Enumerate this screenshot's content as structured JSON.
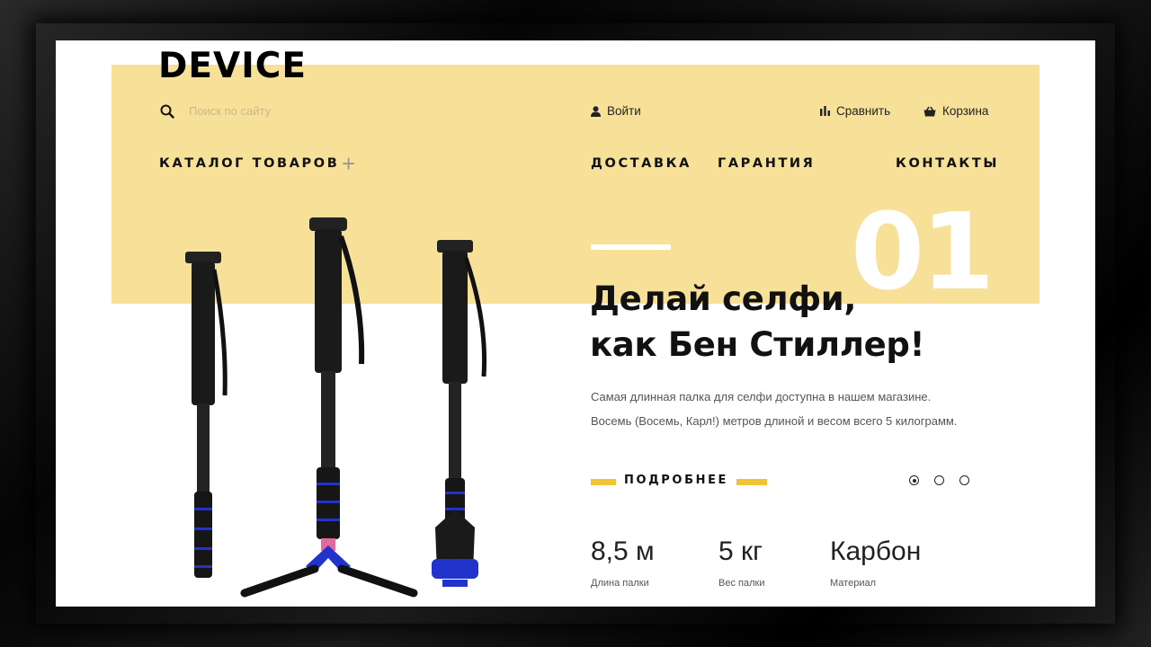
{
  "header": {
    "logo": "DEVICE",
    "search_placeholder": "Поиск по сайту",
    "login": "Войти",
    "compare": "Сравнить",
    "cart": "Корзина"
  },
  "nav": {
    "catalog": "КАТАЛОГ ТОВАРОВ",
    "delivery": "ДОСТАВКА",
    "warranty": "ГАРАНТИЯ",
    "contacts": "КОНТАКТЫ"
  },
  "slide": {
    "number": "01",
    "title_line1": "Делай селфи,",
    "title_line2": "как Бен Стиллер!",
    "desc_line1": "Самая длинная палка для селфи доступна в нашем магазине.",
    "desc_line2": "Восемь (Восемь, Карл!) метров длиной и весом всего 5 килограмм.",
    "more_button": "ПОДРОБНЕЕ",
    "active_slide_index": 0,
    "slide_count": 3
  },
  "stats": [
    {
      "value": "8,5 м",
      "label": "Длина палки"
    },
    {
      "value": "5 кг",
      "label": "Вес палки"
    },
    {
      "value": "Карбон",
      "label": "Материал"
    }
  ],
  "colors": {
    "banner_yellow": "#f7e199",
    "accent_yellow": "#f2c332",
    "text_dark": "#111111",
    "leg_blue": "#2233cc",
    "leg_pink": "#e06aa0"
  }
}
